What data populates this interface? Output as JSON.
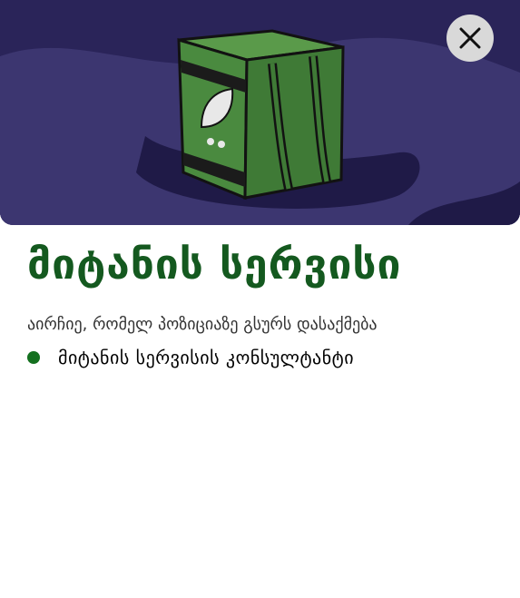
{
  "hero": {
    "illustration": "green-delivery-backpack",
    "colors": {
      "background": "#2a2459",
      "shape": "#3c3670",
      "bag": "#4a8a3f"
    }
  },
  "close_button": {
    "icon": "close-icon"
  },
  "title": "მიტანის სერვისი",
  "subtitle": "აირჩიე, რომელ პოზიციაზე გსურს დასაქმება",
  "options": [
    {
      "label": "მიტანის სერვისის კონსულტანტი",
      "color": "#14701f"
    }
  ]
}
